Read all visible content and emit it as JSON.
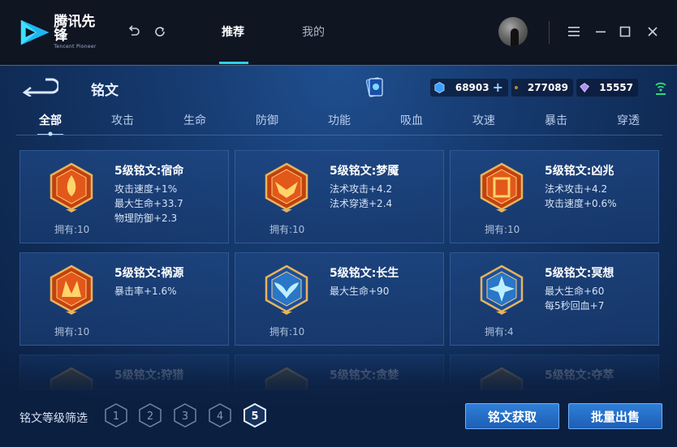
{
  "titlebar": {
    "logo_cn": "腾讯先锋",
    "logo_en": "Tencent Pioneer",
    "tabs": [
      {
        "label": "推荐",
        "active": true
      },
      {
        "label": "我的",
        "active": false
      }
    ],
    "accent": "#2ad2e8"
  },
  "page": {
    "title": "铭文"
  },
  "currencies": [
    {
      "icon": "coupon-icon",
      "value": "68903",
      "has_plus": true
    },
    {
      "icon": "gold-coin-icon",
      "value": "277089"
    },
    {
      "icon": "crystal-icon",
      "value": "15557"
    }
  ],
  "categories": [
    "全部",
    "攻击",
    "生命",
    "防御",
    "功能",
    "吸血",
    "攻速",
    "暴击",
    "穿透"
  ],
  "active_category": "全部",
  "inscriptions": [
    {
      "name": "5级铭文:宿命",
      "stats": [
        "攻击速度+1%",
        "最大生命+33.7",
        "物理防御+2.3"
      ],
      "owned": "拥有:10",
      "color": "red",
      "symbol": "flame"
    },
    {
      "name": "5级铭文:梦魇",
      "stats": [
        "法术攻击+4.2",
        "法术穿透+2.4"
      ],
      "owned": "拥有:10",
      "color": "red",
      "symbol": "wing"
    },
    {
      "name": "5级铭文:凶兆",
      "stats": [
        "法术攻击+4.2",
        "攻击速度+0.6%"
      ],
      "owned": "拥有:10",
      "color": "red",
      "symbol": "gate"
    },
    {
      "name": "5级铭文:祸源",
      "stats": [
        "暴击率+1.6%"
      ],
      "owned": "拥有:10",
      "color": "red",
      "symbol": "fan"
    },
    {
      "name": "5级铭文:长生",
      "stats": [
        "最大生命+90"
      ],
      "owned": "拥有:10",
      "color": "blue",
      "symbol": "tail"
    },
    {
      "name": "5级铭文:冥想",
      "stats": [
        "最大生命+60",
        "每5秒回血+7"
      ],
      "owned": "拥有:4",
      "color": "blue",
      "symbol": "crystal"
    },
    {
      "name": "5级铭文:狩猎",
      "stats": [],
      "owned": "",
      "color": "gold",
      "symbol": "faded"
    },
    {
      "name": "5级铭文:贪婪",
      "stats": [],
      "owned": "",
      "color": "gold",
      "symbol": "faded"
    },
    {
      "name": "5级铭文:夺萃",
      "stats": [],
      "owned": "",
      "color": "gold",
      "symbol": "faded"
    }
  ],
  "filter": {
    "label": "铭文等级筛选",
    "levels": [
      "1",
      "2",
      "3",
      "4",
      "5"
    ],
    "selected": "5"
  },
  "actions": {
    "acquire": "铭文获取",
    "bulk_sell": "批量出售"
  }
}
